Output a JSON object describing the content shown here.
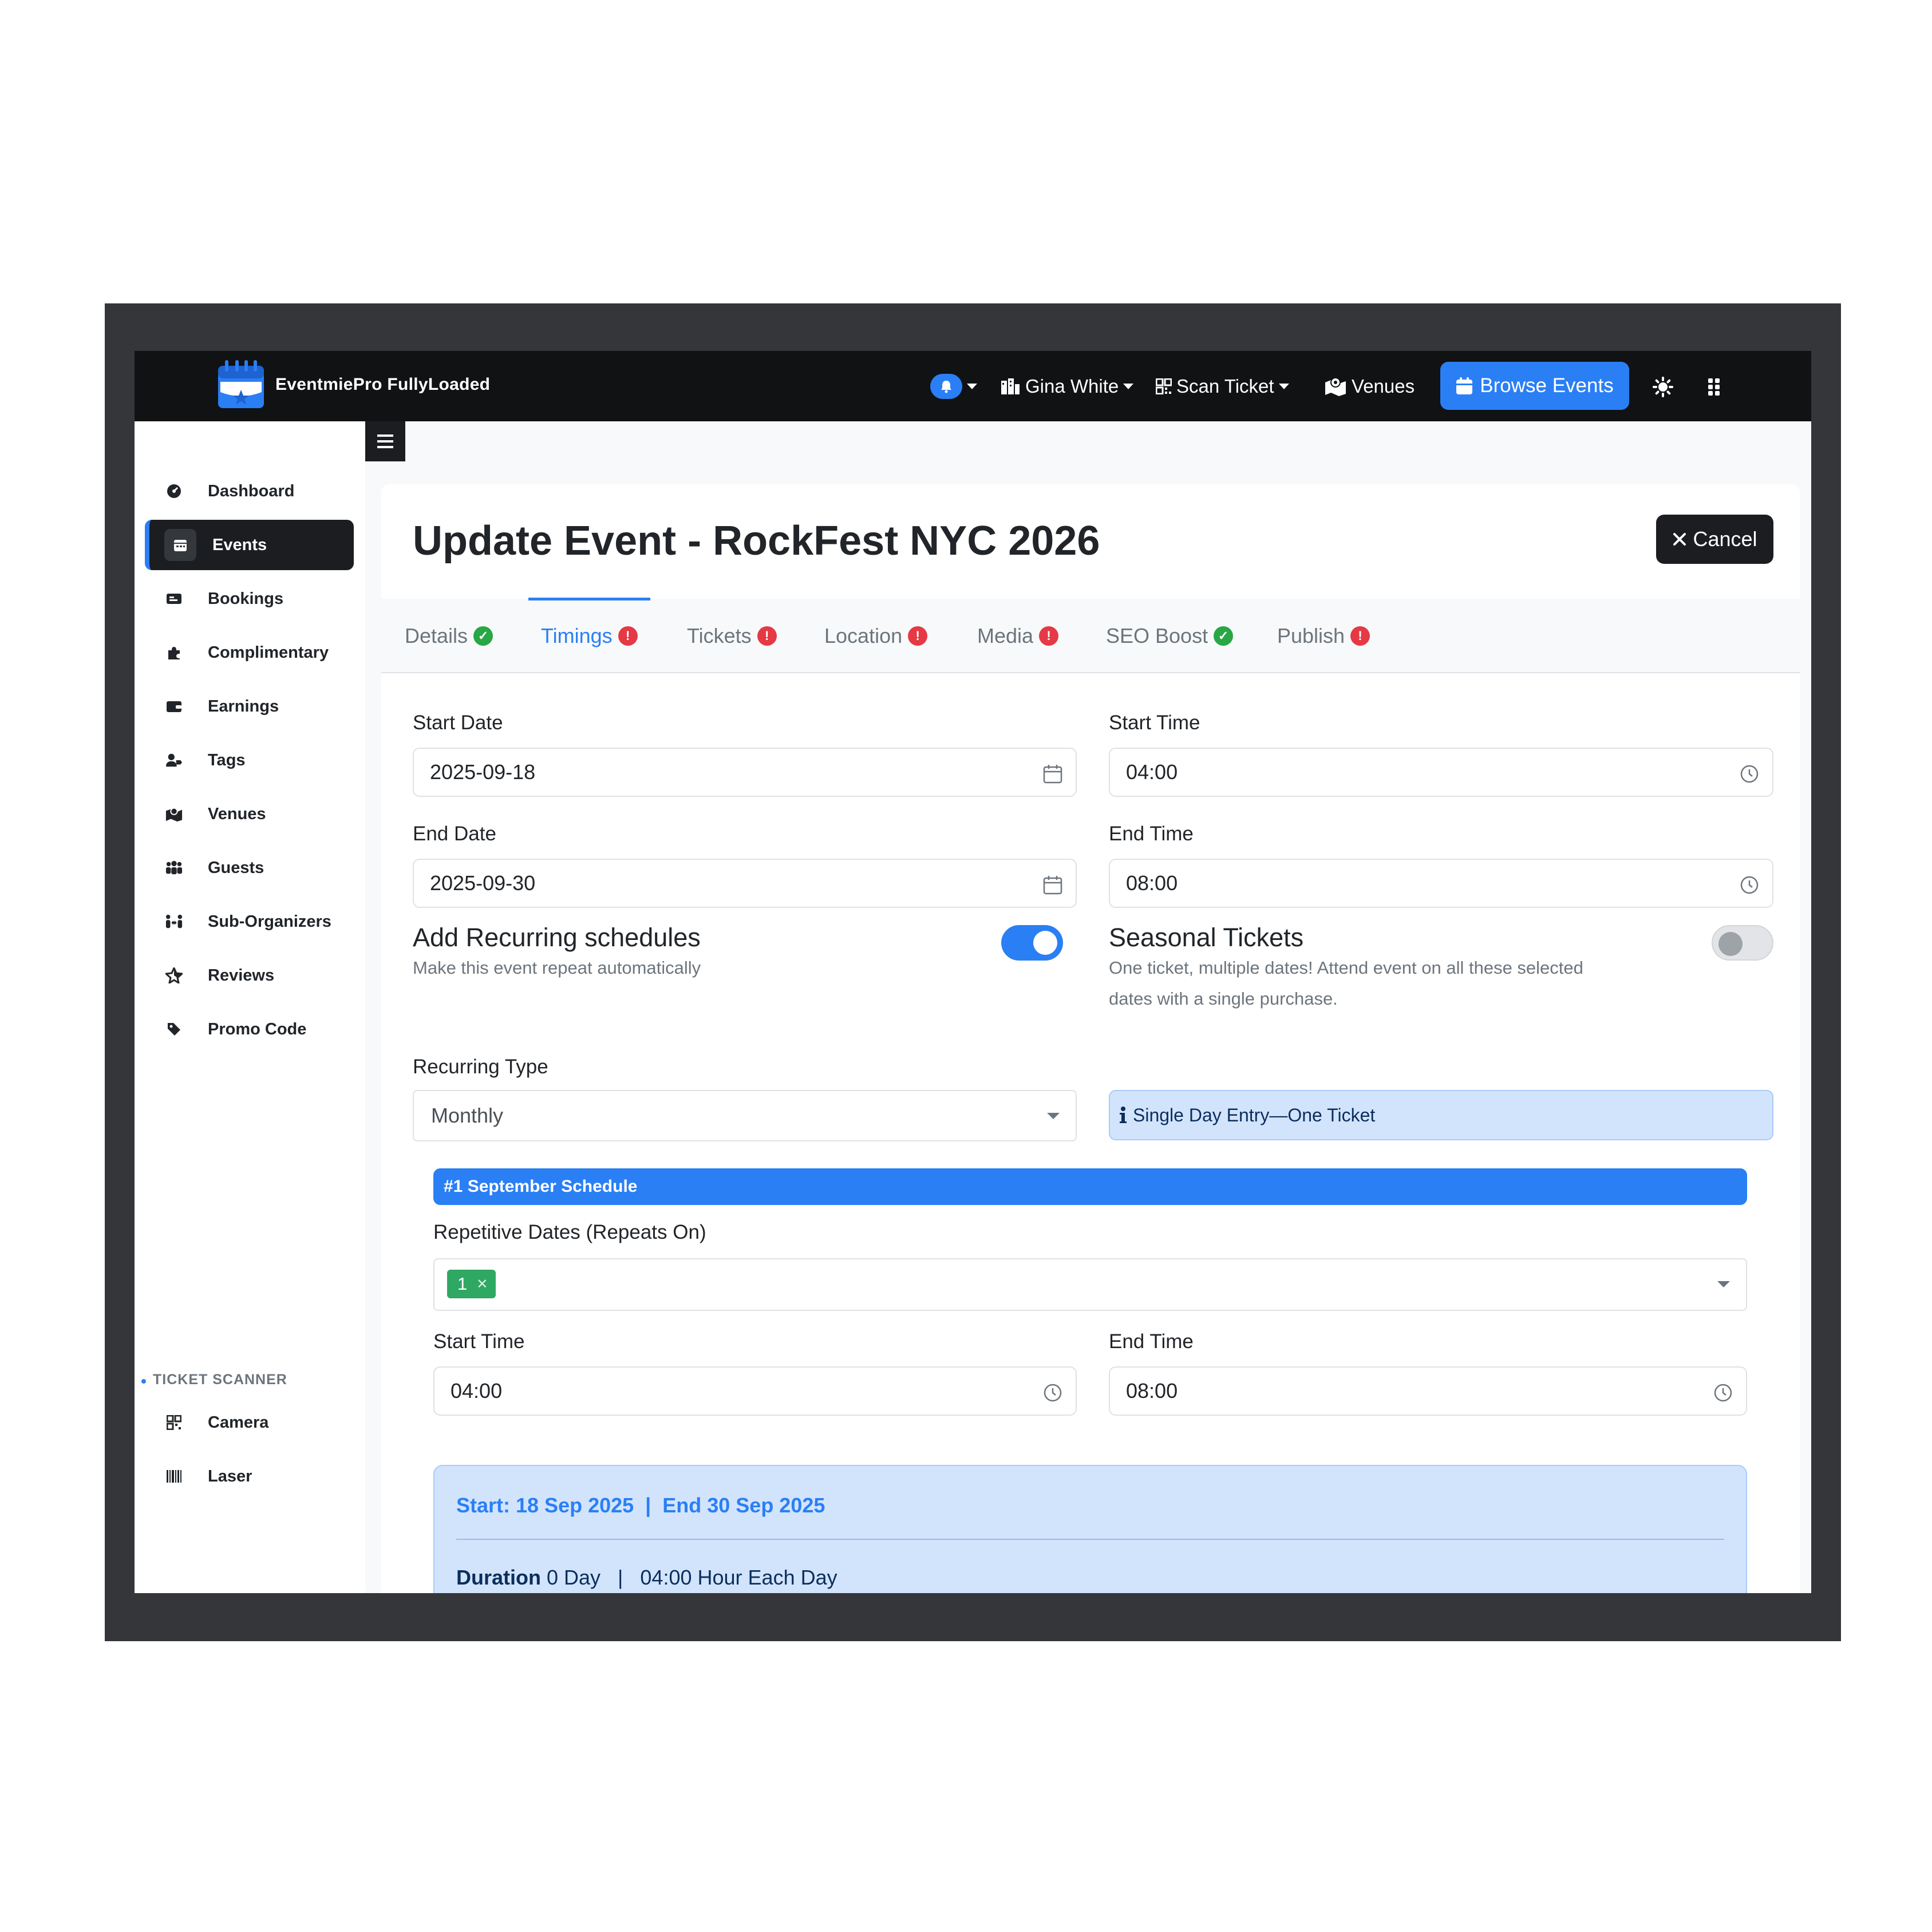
{
  "app": {
    "brand": "EventmiePro FullyLoaded"
  },
  "navbar": {
    "user_name": "Gina White",
    "scan_ticket": "Scan Ticket",
    "venues": "Venues",
    "browse_events": "Browse Events",
    "accent": "#2a7ff5"
  },
  "sidebar": {
    "items": [
      {
        "label": "Dashboard",
        "icon": "dashboard-icon"
      },
      {
        "label": "Events",
        "icon": "calendar-icon",
        "active": true
      },
      {
        "label": "Bookings",
        "icon": "ticket-icon"
      },
      {
        "label": "Complimentary",
        "icon": "puzzle-icon"
      },
      {
        "label": "Earnings",
        "icon": "wallet-icon"
      },
      {
        "label": "Tags",
        "icon": "user-tag-icon"
      },
      {
        "label": "Venues",
        "icon": "map-icon"
      },
      {
        "label": "Guests",
        "icon": "people-group-icon"
      },
      {
        "label": "Sub-Organizers",
        "icon": "people-arrows-icon"
      },
      {
        "label": "Reviews",
        "icon": "star-icon"
      },
      {
        "label": "Promo Code",
        "icon": "tag-icon"
      }
    ],
    "scanner_section": "TICKET SCANNER",
    "scanner_items": [
      {
        "label": "Camera",
        "icon": "qrcode-icon"
      },
      {
        "label": "Laser",
        "icon": "barcode-icon"
      }
    ]
  },
  "page": {
    "title": "Update Event - RockFest NYC 2026",
    "cancel": "Cancel"
  },
  "tabs": [
    {
      "label": "Details",
      "status": "ok"
    },
    {
      "label": "Timings",
      "status": "error",
      "active": true
    },
    {
      "label": "Tickets",
      "status": "error"
    },
    {
      "label": "Location",
      "status": "error"
    },
    {
      "label": "Media",
      "status": "error"
    },
    {
      "label": "SEO Boost",
      "status": "ok"
    },
    {
      "label": "Publish",
      "status": "error"
    }
  ],
  "form": {
    "start_date_label": "Start Date",
    "start_date": "2025-09-18",
    "start_time_label": "Start Time",
    "start_time": "04:00",
    "end_date_label": "End Date",
    "end_date": "2025-09-30",
    "end_time_label": "End Time",
    "end_time": "08:00",
    "recurring": {
      "title": "Add Recurring schedules",
      "help": "Make this event repeat automatically",
      "enabled": true
    },
    "seasonal": {
      "title": "Seasonal Tickets",
      "help_line1": "One ticket, multiple dates! Attend event on all these selected",
      "help_line2": "dates with a single purchase.",
      "enabled": false
    },
    "recurring_type_label": "Recurring Type",
    "recurring_type": "Monthly",
    "entry_info": "Single Day Entry—One Ticket"
  },
  "schedule": {
    "heading": "#1  September Schedule",
    "repeat_label": "Repetitive Dates (Repeats On)",
    "repeat_tags": [
      "1"
    ],
    "start_time_label": "Start Time",
    "start_time": "04:00",
    "end_time_label": "End Time",
    "end_time": "08:00",
    "summary_range": "Start: 18 Sep 2025  |  End 30 Sep 2025",
    "duration_label": "Duration",
    "duration_text": " 0 Day   |   04:00 Hour Each Day"
  }
}
